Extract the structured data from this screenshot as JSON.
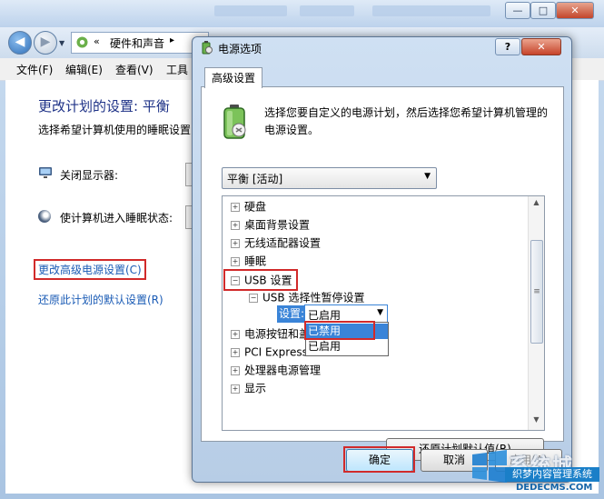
{
  "background_window": {
    "address_bar": {
      "chevrons": "«",
      "path": "硬件和声音",
      "next_chevron": "▸"
    },
    "controls": {
      "minimize": "—",
      "maximize": "□",
      "close": "✕"
    },
    "menu": [
      "文件(F)",
      "编辑(E)",
      "查看(V)",
      "工具"
    ],
    "content": {
      "title": "更改计划的设置: 平衡",
      "description": "选择希望计算机使用的睡眠设置",
      "display_label": "关闭显示器:",
      "sleep_label": "使计算机进入睡眠状态:",
      "advanced_link": "更改高级电源设置(C)",
      "restore_link": "还原此计划的默认设置(R)"
    }
  },
  "dialog": {
    "title": "电源选项",
    "help": "?",
    "close": "✕",
    "tab": "高级设置",
    "intro": "选择您要自定义的电源计划，然后选择您希望计算机管理的电源设置。",
    "plan_selector": {
      "value": "平衡 [活动]",
      "arrow": "▼"
    },
    "tree": [
      {
        "label": "硬盘",
        "expander": "+"
      },
      {
        "label": "桌面背景设置",
        "expander": "+"
      },
      {
        "label": "无线适配器设置",
        "expander": "+"
      },
      {
        "label": "睡眠",
        "expander": "+"
      },
      {
        "label": "USB 设置",
        "expander": "−"
      },
      {
        "label": "USB 选择性暂停设置",
        "expander": "−"
      },
      {
        "label": "电源按钮和盖",
        "expander": "+"
      },
      {
        "label": "PCI Express",
        "expander": "+"
      },
      {
        "label": "处理器电源管理",
        "expander": "+"
      },
      {
        "label": "显示",
        "expander": "+"
      }
    ],
    "setting": {
      "label": "设置:",
      "value": "已启用",
      "arrow": "▼",
      "options": [
        "已禁用",
        "已启用"
      ],
      "highlighted_option": "已禁用"
    },
    "scroll": {
      "up": "▲",
      "grip": "≡",
      "down": "▼"
    },
    "restore_defaults": "还原计划默认值(R)",
    "buttons": {
      "ok": "确定",
      "cancel": "取消",
      "apply": "应用(A)"
    }
  },
  "watermark": {
    "text": "系统城",
    "tag": "织梦内容管理系统",
    "url": "DEDECMS.COM"
  },
  "colors": {
    "highlight": "#3a84d8",
    "annotation_red": "#d12a2a",
    "link": "#1a5bb5"
  }
}
